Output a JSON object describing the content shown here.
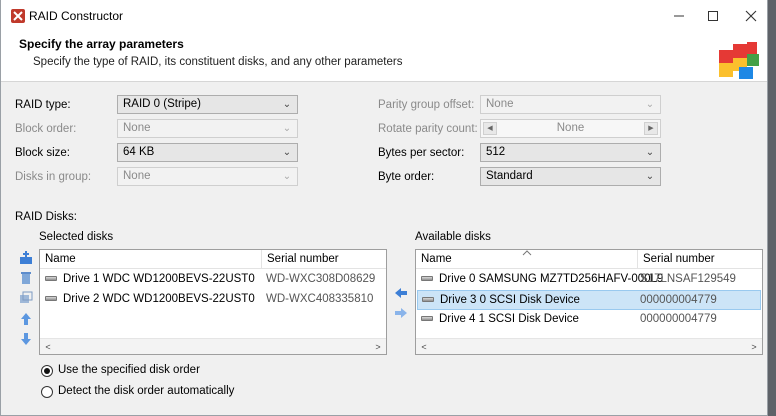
{
  "window": {
    "title": "RAID Constructor",
    "minimize_icon": "minimize-icon",
    "maximize_icon": "maximize-icon",
    "close_icon": "close-icon"
  },
  "header": {
    "title": "Specify the array parameters",
    "subtitle": "Specify the type of RAID, its constituent disks, and any other parameters",
    "icon": "puzzle-icon",
    "icon_colors": [
      "#e53935",
      "#fbc02d",
      "#43a047",
      "#1e88e5"
    ]
  },
  "params_left": {
    "raid_type": {
      "label": "RAID type:",
      "value": "RAID 0 (Stripe)",
      "enabled": true
    },
    "block_order": {
      "label": "Block order:",
      "value": "None",
      "enabled": false
    },
    "block_size": {
      "label": "Block size:",
      "value": "64 KB",
      "enabled": true
    },
    "disks_in_group": {
      "label": "Disks in group:",
      "value": "None",
      "enabled": false
    }
  },
  "params_right": {
    "parity_group_offset": {
      "label": "Parity group offset:",
      "value": "None",
      "enabled": false
    },
    "rotate_parity_count": {
      "label": "Rotate parity count:",
      "value": "None",
      "enabled": false
    },
    "bytes_per_sector": {
      "label": "Bytes per sector:",
      "value": "512",
      "enabled": true
    },
    "byte_order": {
      "label": "Byte order:",
      "value": "Standard",
      "enabled": true
    }
  },
  "raid_disks_label": "RAID Disks:",
  "selected_disks": {
    "label": "Selected disks",
    "columns": [
      "Name",
      "Serial number"
    ],
    "rows": [
      {
        "name": "Drive 1 WDC WD1200BEVS-22UST0",
        "serial": "WD-WXC308D08629"
      },
      {
        "name": "Drive 2 WDC WD1200BEVS-22UST0",
        "serial": "WD-WXC408335810"
      }
    ]
  },
  "available_disks": {
    "label": "Available disks",
    "columns": [
      "Name",
      "Serial number"
    ],
    "rows": [
      {
        "name": "Drive 0 SAMSUNG MZ7TD256HAFV-000L9",
        "serial": "S17LNSAF129549",
        "selected": false
      },
      {
        "name": "Drive 3 0 SCSI Disk Device",
        "serial": "000000004779",
        "selected": true
      },
      {
        "name": "Drive 4 1 SCSI Disk Device",
        "serial": "000000004779",
        "selected": false
      }
    ]
  },
  "side_tools": [
    "add-disk-icon",
    "remove-disk-icon",
    "copy-disk-icon",
    "move-up-icon",
    "move-down-icon"
  ],
  "transfer_buttons": [
    "move-left-icon",
    "move-right-icon"
  ],
  "disk_order_options": [
    {
      "label": "Use the specified disk order",
      "checked": true
    },
    {
      "label": "Detect the disk order automatically",
      "checked": false
    }
  ],
  "colors": {
    "selection": "#cce4f7",
    "accent_blue": "#3d7fd6"
  }
}
